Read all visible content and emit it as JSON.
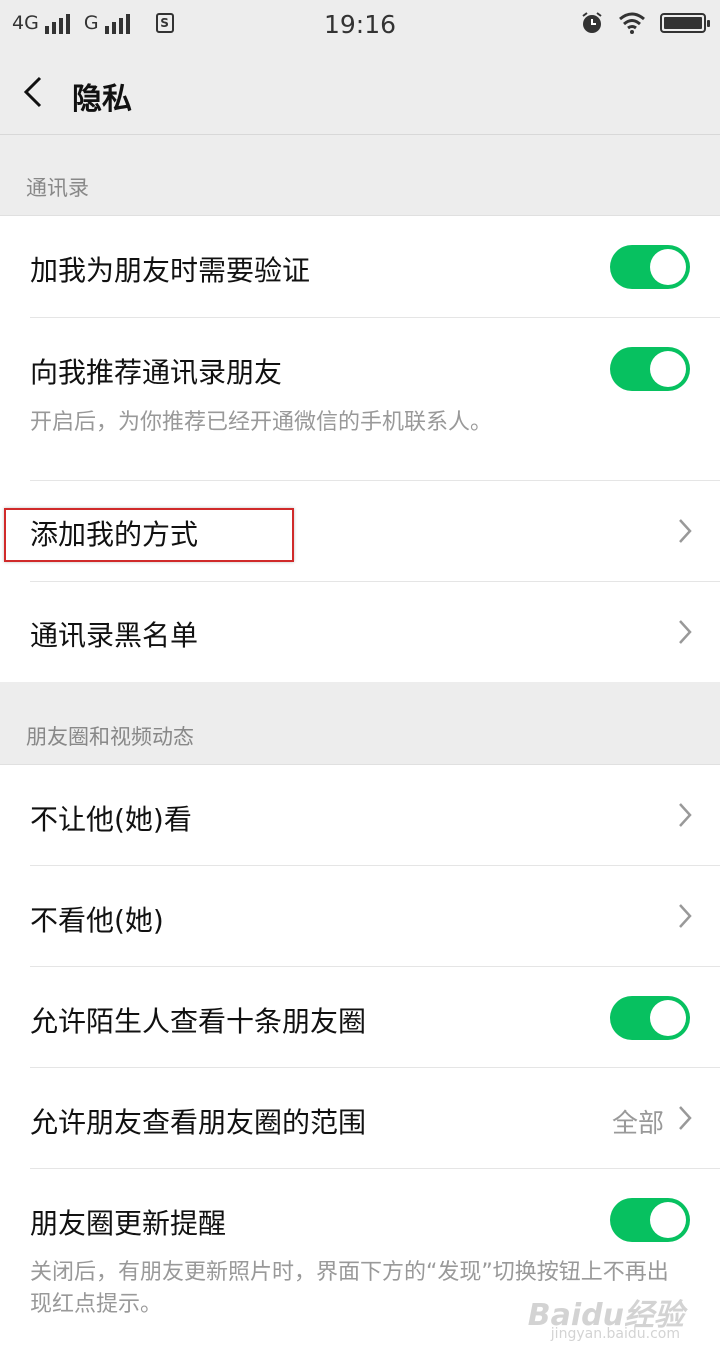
{
  "status_bar": {
    "network1": "4G",
    "network2": "G",
    "time": "19:16"
  },
  "header": {
    "title": "隐私"
  },
  "sections": {
    "contacts": {
      "title": "通讯录",
      "rows": {
        "verify": {
          "label": "加我为朋友时需要验证",
          "toggle": true
        },
        "recommend": {
          "label": "向我推荐通讯录朋友",
          "desc": "开启后，为你推荐已经开通微信的手机联系人。",
          "toggle": true
        },
        "add_methods": {
          "label": "添加我的方式"
        },
        "blacklist": {
          "label": "通讯录黑名单"
        }
      }
    },
    "moments": {
      "title": "朋友圈和视频动态",
      "rows": {
        "dont_let_see": {
          "label": "不让他(她)看"
        },
        "dont_see": {
          "label": "不看他(她)"
        },
        "strangers_ten": {
          "label": "允许陌生人查看十条朋友圈",
          "toggle": true
        },
        "friends_range": {
          "label": "允许朋友查看朋友圈的范围",
          "value": "全部"
        },
        "update_reminder": {
          "label": "朋友圈更新提醒",
          "desc": "关闭后，有朋友更新照片时，界面下方的“发现”切换按钮上不再出现红点提示。",
          "toggle": true
        }
      }
    }
  },
  "watermark": {
    "text": "Baidu经验",
    "sub": "jingyan.baidu.com"
  },
  "colors": {
    "accent": "#07c160",
    "highlight": "#d02a2a",
    "background": "#ededed"
  }
}
